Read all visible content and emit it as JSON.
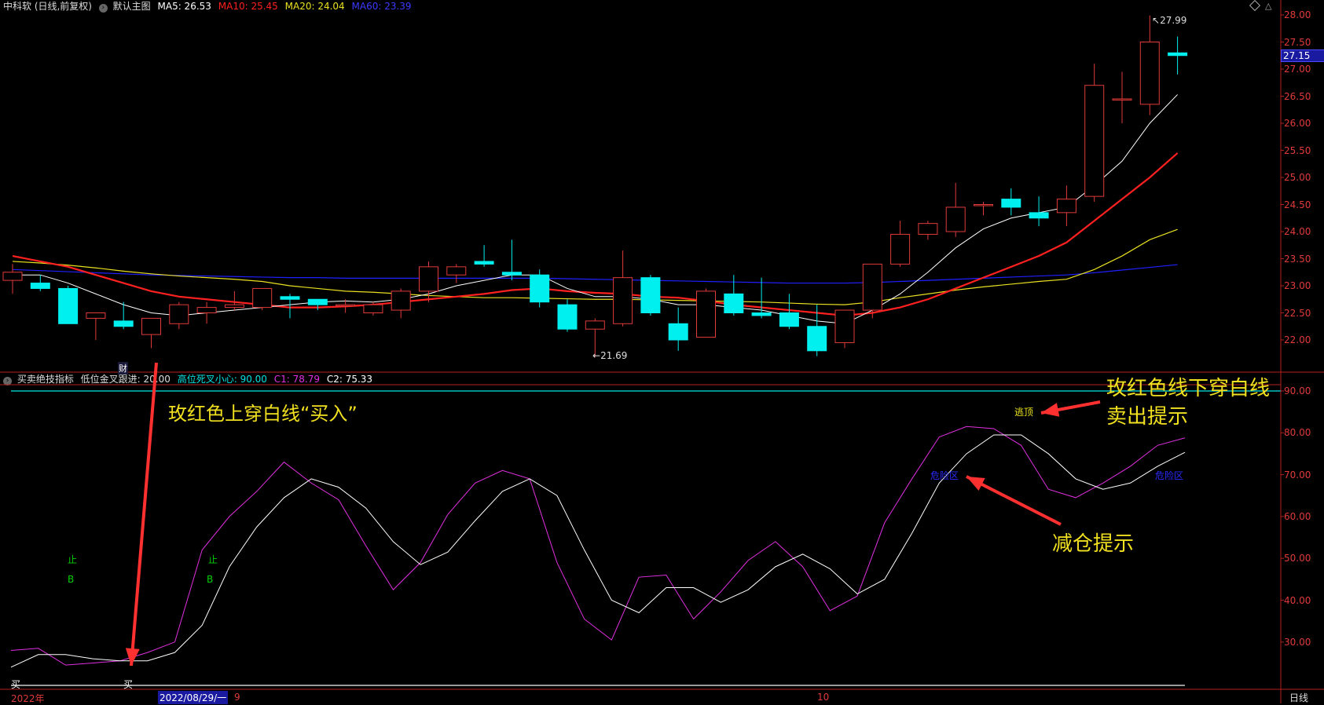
{
  "header": {
    "stock": "中科软 (日线,前复权)",
    "template_icon": "circle-chevron-icon",
    "template": "默认主图",
    "ma5": "MA5: 26.53",
    "ma10": "MA10: 25.45",
    "ma20": "MA20: 24.04",
    "ma60": "MA60: 23.39"
  },
  "indicator_header": {
    "name": "买卖绝技指标",
    "low": "低位金叉跟进: 20.00",
    "high": "高位死叉小心: 90.00",
    "c1": "C1: 78.79",
    "c2": "C2: 75.33"
  },
  "colors": {
    "up": "#e03a3a",
    "down": "#00f0f0",
    "ma5": "#ffffff",
    "ma10": "#ff2020",
    "ma20": "#e8e020",
    "ma60": "#2020ff",
    "c1": "#e030e0",
    "c2": "#ffffff"
  },
  "chart_data": [
    {
      "type": "candlestick",
      "title": "中科软 (日线,前复权)",
      "ylim": [
        21.5,
        28.2
      ],
      "y_ticks": [
        "28.00",
        "27.50",
        "27.00",
        "26.50",
        "26.00",
        "25.50",
        "25.00",
        "24.50",
        "24.00",
        "23.50",
        "23.00",
        "22.50",
        "22.00"
      ],
      "last_price": "27.15",
      "high_label": "27.99",
      "low_label": "21.69",
      "event_marker": "财",
      "candles": [
        [
          23.1,
          23.25,
          23.4,
          22.85
        ],
        [
          23.05,
          22.95,
          23.2,
          22.9
        ],
        [
          22.95,
          22.3,
          23.0,
          22.3
        ],
        [
          22.4,
          22.5,
          22.5,
          22.0
        ],
        [
          22.35,
          22.25,
          22.7,
          22.2
        ],
        [
          22.1,
          22.4,
          22.4,
          21.85
        ],
        [
          22.3,
          22.65,
          22.7,
          22.2
        ],
        [
          22.5,
          22.6,
          22.7,
          22.3
        ],
        [
          22.6,
          22.65,
          22.9,
          22.55
        ],
        [
          22.6,
          22.95,
          22.95,
          22.55
        ],
        [
          22.8,
          22.75,
          22.85,
          22.4
        ],
        [
          22.75,
          22.65,
          22.75,
          22.55
        ],
        [
          22.65,
          22.65,
          22.75,
          22.5
        ],
        [
          22.5,
          22.65,
          22.7,
          22.45
        ],
        [
          22.55,
          22.9,
          22.95,
          22.4
        ],
        [
          22.9,
          23.35,
          23.45,
          22.7
        ],
        [
          23.2,
          23.35,
          23.4,
          23.05
        ],
        [
          23.45,
          23.4,
          23.75,
          23.35
        ],
        [
          23.25,
          23.2,
          23.85,
          23.1
        ],
        [
          23.2,
          22.7,
          23.3,
          22.6
        ],
        [
          22.65,
          22.2,
          22.75,
          22.15
        ],
        [
          22.2,
          22.35,
          22.4,
          21.69
        ],
        [
          22.3,
          23.15,
          23.65,
          22.25
        ],
        [
          23.15,
          22.5,
          23.2,
          22.45
        ],
        [
          22.3,
          22.0,
          22.6,
          21.8
        ],
        [
          22.05,
          22.9,
          22.95,
          22.05
        ],
        [
          22.85,
          22.5,
          23.2,
          22.45
        ],
        [
          22.5,
          22.45,
          23.15,
          22.4
        ],
        [
          22.5,
          22.25,
          22.85,
          22.2
        ],
        [
          22.25,
          21.8,
          22.65,
          21.7
        ],
        [
          21.95,
          22.55,
          22.55,
          21.85
        ],
        [
          22.55,
          23.4,
          23.4,
          22.4
        ],
        [
          23.4,
          23.95,
          24.2,
          23.35
        ],
        [
          23.95,
          24.15,
          24.2,
          23.85
        ],
        [
          24.0,
          24.45,
          24.9,
          23.9
        ],
        [
          24.5,
          24.5,
          24.55,
          24.3
        ],
        [
          24.6,
          24.45,
          24.8,
          24.3
        ],
        [
          24.35,
          24.25,
          24.65,
          24.1
        ],
        [
          24.35,
          24.6,
          24.85,
          24.1
        ],
        [
          24.65,
          26.7,
          27.1,
          24.55
        ],
        [
          26.45,
          26.45,
          26.95,
          26.0
        ],
        [
          26.35,
          27.5,
          27.99,
          26.15
        ],
        [
          27.3,
          27.25,
          27.6,
          26.9
        ]
      ],
      "ma5": [
        23.2,
        23.2,
        23.05,
        22.85,
        22.65,
        22.5,
        22.45,
        22.5,
        22.55,
        22.6,
        22.65,
        22.7,
        22.72,
        22.7,
        22.75,
        22.85,
        23.0,
        23.1,
        23.2,
        23.2,
        22.95,
        22.8,
        22.8,
        22.75,
        22.65,
        22.65,
        22.6,
        22.55,
        22.45,
        22.35,
        22.3,
        22.55,
        22.85,
        23.25,
        23.7,
        24.05,
        24.25,
        24.35,
        24.45,
        24.85,
        25.3,
        26.0,
        26.53
      ],
      "ma10": [
        23.55,
        23.45,
        23.35,
        23.2,
        23.05,
        22.9,
        22.8,
        22.75,
        22.7,
        22.65,
        22.6,
        22.6,
        22.62,
        22.65,
        22.7,
        22.75,
        22.8,
        22.85,
        22.92,
        22.95,
        22.9,
        22.87,
        22.85,
        22.8,
        22.78,
        22.72,
        22.65,
        22.6,
        22.55,
        22.5,
        22.45,
        22.5,
        22.6,
        22.75,
        22.95,
        23.15,
        23.35,
        23.55,
        23.8,
        24.2,
        24.6,
        25.0,
        25.45
      ],
      "ma20": [
        23.45,
        23.42,
        23.38,
        23.33,
        23.27,
        23.22,
        23.18,
        23.15,
        23.12,
        23.08,
        23.0,
        22.95,
        22.9,
        22.88,
        22.85,
        22.82,
        22.8,
        22.78,
        22.78,
        22.77,
        22.76,
        22.75,
        22.75,
        22.74,
        22.73,
        22.72,
        22.71,
        22.7,
        22.68,
        22.66,
        22.65,
        22.7,
        22.78,
        22.85,
        22.92,
        22.98,
        23.03,
        23.08,
        23.12,
        23.3,
        23.55,
        23.85,
        24.04
      ],
      "ma60": [
        23.3,
        23.28,
        23.26,
        23.24,
        23.22,
        23.2,
        23.19,
        23.18,
        23.17,
        23.16,
        23.15,
        23.15,
        23.14,
        23.14,
        23.14,
        23.14,
        23.14,
        23.14,
        23.14,
        23.14,
        23.13,
        23.12,
        23.11,
        23.1,
        23.09,
        23.08,
        23.07,
        23.06,
        23.05,
        23.05,
        23.05,
        23.06,
        23.08,
        23.1,
        23.12,
        23.14,
        23.16,
        23.18,
        23.2,
        23.24,
        23.29,
        23.34,
        23.39
      ]
    },
    {
      "type": "line",
      "title": "买卖绝技指标",
      "ylim": [
        20,
        92
      ],
      "y_ticks": [
        "90.00",
        "80.00",
        "70.00",
        "60.00",
        "50.00",
        "40.00",
        "30.00"
      ],
      "reference_level": 90,
      "series": [
        {
          "name": "C1",
          "color": "#e030e0",
          "values": [
            28,
            28.5,
            24.5,
            25,
            25.5,
            27.5,
            30,
            52,
            60,
            66,
            73,
            68,
            64,
            53,
            42.5,
            49,
            60.5,
            68,
            71,
            69,
            49,
            35.5,
            30.5,
            45.5,
            46,
            35.5,
            42,
            49.5,
            54,
            48,
            37.5,
            41,
            58.5,
            69,
            79,
            81.5,
            81,
            77,
            66.5,
            64.5,
            68,
            72,
            77,
            78.79
          ]
        },
        {
          "name": "C2",
          "color": "#ffffff",
          "values": [
            24,
            27,
            27,
            26,
            25.5,
            25.5,
            27.5,
            34,
            48,
            57.5,
            64.5,
            69,
            67,
            62,
            54,
            48.5,
            51.5,
            59,
            66,
            69,
            65,
            52,
            40,
            37,
            43,
            43,
            39.5,
            42.5,
            48,
            51,
            47.5,
            41.5,
            45,
            56,
            68,
            75,
            79.5,
            79.5,
            75,
            69,
            66.5,
            68,
            72,
            75.33
          ]
        }
      ],
      "signals": {
        "buy_top": "止",
        "buy_bottom": "B",
        "escape": "逃顶",
        "risk": "危险区",
        "buy_text": "买"
      }
    }
  ],
  "x_axis": {
    "year": "2022年",
    "date_highlight": "2022/08/29/一",
    "sep": "9",
    "month": "10",
    "period": "日线"
  },
  "annotations": {
    "buy": "玫红色上穿白线“买入”",
    "sell_line1": "玫红色线下穿白线",
    "sell_line2": "卖出提示",
    "reduce": "减仓提示"
  }
}
